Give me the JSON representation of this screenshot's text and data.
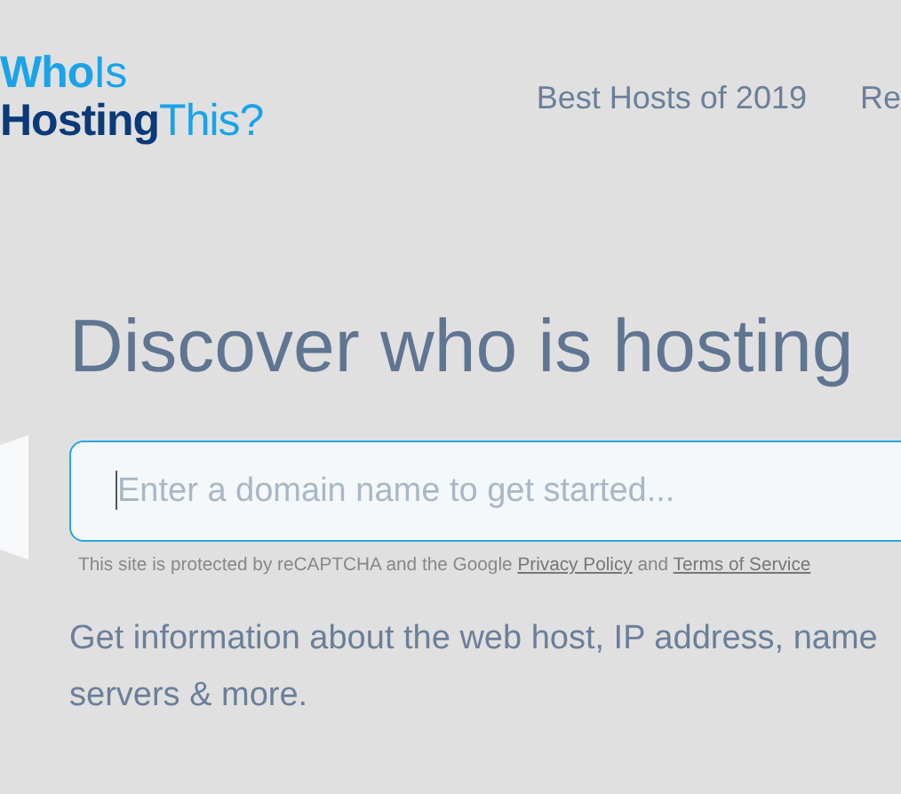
{
  "logo": {
    "lines": [
      {
        "strong": "Who",
        "light": "Is"
      },
      {
        "strong": "Hosting",
        "light": "This?"
      }
    ]
  },
  "nav": {
    "items": [
      {
        "label": "Best Hosts of 2019"
      },
      {
        "label": "Re"
      }
    ]
  },
  "hero": {
    "heading": "Discover who is hosting",
    "search": {
      "placeholder": "Enter a domain name to get started...",
      "focused": true
    },
    "recaptcha": {
      "text": "This site is protected by reCAPTCHA and the Google",
      "link_1": "Privacy Policy",
      "joiner": "and",
      "link_2": "Terms of Service"
    },
    "description": "Get information about the web host, IP address, name servers & more."
  }
}
